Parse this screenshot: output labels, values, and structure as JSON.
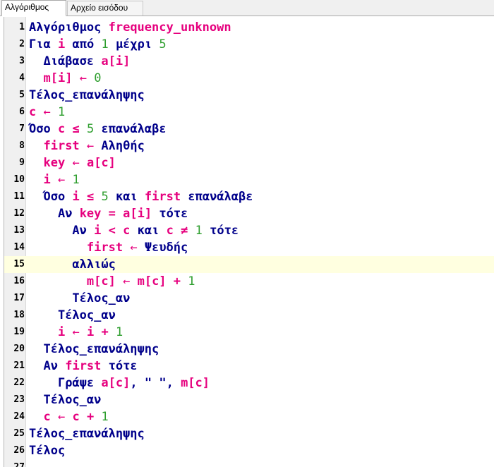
{
  "tabs": [
    {
      "label": "Αλγόριθμος",
      "active": true
    },
    {
      "label": "Αρχείο εισόδου",
      "active": false
    }
  ],
  "editor": {
    "current_line": 15,
    "lines": [
      {
        "n": "1",
        "tokens": [
          [
            "k",
            "Αλγόριθμος"
          ],
          [
            "t",
            " "
          ],
          [
            "v",
            "frequency_unknown"
          ]
        ]
      },
      {
        "n": "2",
        "tokens": [
          [
            "k",
            "Για"
          ],
          [
            "t",
            " "
          ],
          [
            "v",
            "i"
          ],
          [
            "t",
            " "
          ],
          [
            "k",
            "από"
          ],
          [
            "t",
            " "
          ],
          [
            "n",
            "1"
          ],
          [
            "t",
            " "
          ],
          [
            "k",
            "μέχρι"
          ],
          [
            "t",
            " "
          ],
          [
            "n",
            "5"
          ]
        ]
      },
      {
        "n": "3",
        "tokens": [
          [
            "t",
            "  "
          ],
          [
            "k",
            "Διάβασε"
          ],
          [
            "t",
            " "
          ],
          [
            "v",
            "a[i]"
          ]
        ]
      },
      {
        "n": "4",
        "tokens": [
          [
            "t",
            "  "
          ],
          [
            "v",
            "m[i]"
          ],
          [
            "t",
            " "
          ],
          [
            "op",
            "←"
          ],
          [
            "t",
            " "
          ],
          [
            "n",
            "0"
          ]
        ]
      },
      {
        "n": "5",
        "tokens": [
          [
            "k",
            "Τέλος_επανάληψης"
          ]
        ]
      },
      {
        "n": "6",
        "tokens": [
          [
            "v",
            "c"
          ],
          [
            "t",
            " "
          ],
          [
            "op",
            "←"
          ],
          [
            "t",
            " "
          ],
          [
            "n",
            "1"
          ]
        ]
      },
      {
        "n": "7",
        "tokens": [
          [
            "k",
            "Όσο"
          ],
          [
            "t",
            " "
          ],
          [
            "v",
            "c"
          ],
          [
            "t",
            " "
          ],
          [
            "o",
            "≤"
          ],
          [
            "t",
            " "
          ],
          [
            "n",
            "5"
          ],
          [
            "t",
            " "
          ],
          [
            "k",
            "επανάλαβε"
          ]
        ]
      },
      {
        "n": "8",
        "tokens": [
          [
            "t",
            "  "
          ],
          [
            "v",
            "first"
          ],
          [
            "t",
            " "
          ],
          [
            "op",
            "←"
          ],
          [
            "t",
            " "
          ],
          [
            "k",
            "Αληθής"
          ]
        ]
      },
      {
        "n": "9",
        "tokens": [
          [
            "t",
            "  "
          ],
          [
            "v",
            "key"
          ],
          [
            "t",
            " "
          ],
          [
            "op",
            "←"
          ],
          [
            "t",
            " "
          ],
          [
            "v",
            "a[c]"
          ]
        ]
      },
      {
        "n": "10",
        "tokens": [
          [
            "t",
            "  "
          ],
          [
            "v",
            "i"
          ],
          [
            "t",
            " "
          ],
          [
            "op",
            "←"
          ],
          [
            "t",
            " "
          ],
          [
            "n",
            "1"
          ]
        ]
      },
      {
        "n": "11",
        "tokens": [
          [
            "t",
            "  "
          ],
          [
            "k",
            "Όσο"
          ],
          [
            "t",
            " "
          ],
          [
            "v",
            "i"
          ],
          [
            "t",
            " "
          ],
          [
            "o",
            "≤"
          ],
          [
            "t",
            " "
          ],
          [
            "n",
            "5"
          ],
          [
            "t",
            " "
          ],
          [
            "k",
            "και"
          ],
          [
            "t",
            " "
          ],
          [
            "v",
            "first"
          ],
          [
            "t",
            " "
          ],
          [
            "k",
            "επανάλαβε"
          ]
        ]
      },
      {
        "n": "12",
        "tokens": [
          [
            "t",
            "    "
          ],
          [
            "k",
            "Αν"
          ],
          [
            "t",
            " "
          ],
          [
            "v",
            "key"
          ],
          [
            "t",
            " "
          ],
          [
            "o",
            "="
          ],
          [
            "t",
            " "
          ],
          [
            "v",
            "a[i]"
          ],
          [
            "t",
            " "
          ],
          [
            "k",
            "τότε"
          ]
        ]
      },
      {
        "n": "13",
        "tokens": [
          [
            "t",
            "      "
          ],
          [
            "k",
            "Αν"
          ],
          [
            "t",
            " "
          ],
          [
            "v",
            "i"
          ],
          [
            "t",
            " "
          ],
          [
            "o",
            "<"
          ],
          [
            "t",
            " "
          ],
          [
            "v",
            "c"
          ],
          [
            "t",
            " "
          ],
          [
            "k",
            "και"
          ],
          [
            "t",
            " "
          ],
          [
            "v",
            "c"
          ],
          [
            "t",
            " "
          ],
          [
            "o",
            "≠"
          ],
          [
            "t",
            " "
          ],
          [
            "n",
            "1"
          ],
          [
            "t",
            " "
          ],
          [
            "k",
            "τότε"
          ]
        ]
      },
      {
        "n": "14",
        "tokens": [
          [
            "t",
            "        "
          ],
          [
            "v",
            "first"
          ],
          [
            "t",
            " "
          ],
          [
            "op",
            "←"
          ],
          [
            "t",
            " "
          ],
          [
            "k",
            "Ψευδής"
          ]
        ]
      },
      {
        "n": "15",
        "tokens": [
          [
            "t",
            "      "
          ],
          [
            "k",
            "αλλιώς"
          ]
        ]
      },
      {
        "n": "16",
        "tokens": [
          [
            "t",
            "        "
          ],
          [
            "v",
            "m[c]"
          ],
          [
            "t",
            " "
          ],
          [
            "op",
            "←"
          ],
          [
            "t",
            " "
          ],
          [
            "v",
            "m[c]"
          ],
          [
            "t",
            " "
          ],
          [
            "o",
            "+"
          ],
          [
            "t",
            " "
          ],
          [
            "n",
            "1"
          ]
        ]
      },
      {
        "n": "17",
        "tokens": [
          [
            "t",
            "      "
          ],
          [
            "k",
            "Τέλος_αν"
          ]
        ]
      },
      {
        "n": "18",
        "tokens": [
          [
            "t",
            "    "
          ],
          [
            "k",
            "Τέλος_αν"
          ]
        ]
      },
      {
        "n": "19",
        "tokens": [
          [
            "t",
            "    "
          ],
          [
            "v",
            "i"
          ],
          [
            "t",
            " "
          ],
          [
            "op",
            "←"
          ],
          [
            "t",
            " "
          ],
          [
            "v",
            "i"
          ],
          [
            "t",
            " "
          ],
          [
            "o",
            "+"
          ],
          [
            "t",
            " "
          ],
          [
            "n",
            "1"
          ]
        ]
      },
      {
        "n": "20",
        "tokens": [
          [
            "t",
            "  "
          ],
          [
            "k",
            "Τέλος_επανάληψης"
          ]
        ]
      },
      {
        "n": "21",
        "tokens": [
          [
            "t",
            "  "
          ],
          [
            "k",
            "Αν"
          ],
          [
            "t",
            " "
          ],
          [
            "v",
            "first"
          ],
          [
            "t",
            " "
          ],
          [
            "k",
            "τότε"
          ]
        ]
      },
      {
        "n": "22",
        "tokens": [
          [
            "t",
            "    "
          ],
          [
            "k",
            "Γράψε"
          ],
          [
            "t",
            " "
          ],
          [
            "v",
            "a[c]"
          ],
          [
            "p",
            ","
          ],
          [
            "t",
            " "
          ],
          [
            "s",
            "\" \""
          ],
          [
            "p",
            ","
          ],
          [
            "t",
            " "
          ],
          [
            "v",
            "m[c]"
          ]
        ]
      },
      {
        "n": "23",
        "tokens": [
          [
            "t",
            "  "
          ],
          [
            "k",
            "Τέλος_αν"
          ]
        ]
      },
      {
        "n": "24",
        "tokens": [
          [
            "t",
            "  "
          ],
          [
            "v",
            "c"
          ],
          [
            "t",
            " "
          ],
          [
            "op",
            "←"
          ],
          [
            "t",
            " "
          ],
          [
            "v",
            "c"
          ],
          [
            "t",
            " "
          ],
          [
            "o",
            "+"
          ],
          [
            "t",
            " "
          ],
          [
            "n",
            "1"
          ]
        ]
      },
      {
        "n": "25",
        "tokens": [
          [
            "k",
            "Τέλος_επανάληψης"
          ]
        ]
      },
      {
        "n": "26",
        "tokens": [
          [
            "k",
            "Τέλος"
          ]
        ]
      },
      {
        "n": "27",
        "tokens": []
      }
    ]
  },
  "colors": {
    "keyword": "#00008b",
    "variable": "#e6007e",
    "number": "#2e9e2e",
    "current_line_bg": "#ffffe0"
  }
}
